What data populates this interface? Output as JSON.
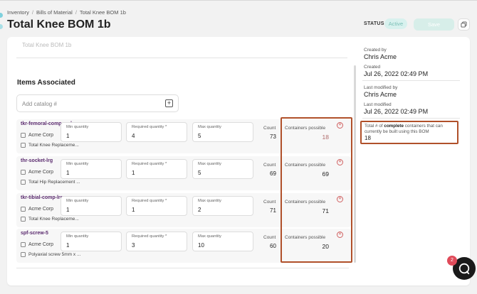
{
  "breadcrumb": [
    "Inventory",
    "Bills of Material",
    "Total Knee BOM 1b"
  ],
  "page_title": "Total Knee BOM 1b",
  "header": {
    "status_label": "STATUS",
    "status_value": "Active",
    "save_label": "Save"
  },
  "name_field_value": "Total Knee BOM 1b",
  "items_section": {
    "title": "Items Associated",
    "add_placeholder": "Add catalog #",
    "rows": [
      {
        "sku": "tkr-femoral-comp-sml",
        "vendor": "Acme Corp",
        "desc": "Total Knee Replaceme...",
        "min_label": "Min quantity",
        "min": "1",
        "req_label": "Required quantity *",
        "req": "4",
        "max_label": "Max quantity",
        "max": "5",
        "count_label": "Count",
        "count": "73",
        "cont_label": "Containers possible",
        "cont": "18"
      },
      {
        "sku": "thr-socket-lrg",
        "vendor": "Acme Corp",
        "desc": "Total Hip Replacement ...",
        "min_label": "Min quantity",
        "min": "1",
        "req_label": "Required quantity *",
        "req": "1",
        "max_label": "Max quantity",
        "max": "5",
        "count_label": "Count",
        "count": "69",
        "cont_label": "Containers possible",
        "cont": "69"
      },
      {
        "sku": "tkr-tibial-comp-lrg",
        "vendor": "Acme Corp",
        "desc": "Total Knee Replaceme...",
        "min_label": "Min quantity",
        "min": "1",
        "req_label": "Required quantity *",
        "req": "1",
        "max_label": "Max quantity",
        "max": "2",
        "count_label": "Count",
        "count": "71",
        "cont_label": "Containers possible",
        "cont": "71"
      },
      {
        "sku": "spf-screw-5",
        "vendor": "Acme Corp",
        "desc": "Polyaxial screw 5mm x ...",
        "min_label": "Min quantity",
        "min": "1",
        "req_label": "Required quantity *",
        "req": "3",
        "max_label": "Max quantity",
        "max": "10",
        "count_label": "Count",
        "count": "60",
        "cont_label": "Containers possible",
        "cont": "20"
      }
    ]
  },
  "sidebar": {
    "created_by_label": "Created by",
    "created_by": "Chris Acme",
    "created_label": "Created",
    "created": "Jul 26, 2022 02:49 PM",
    "modified_by_label": "Last modified by",
    "modified_by": "Chris Acme",
    "modified_label": "Last modified",
    "modified": "Jul 26, 2022 02:49 PM",
    "callout_pre": "Total # of ",
    "callout_bold": "complete",
    "callout_post": " containers that can currently be built using this BOM",
    "callout_value": "18"
  },
  "chat_badge": "2",
  "colors": {
    "accent": "#5a2a6e",
    "highlight": "#b0502a",
    "status_bg": "#d8f1ee",
    "badge": "#e04b5a"
  }
}
